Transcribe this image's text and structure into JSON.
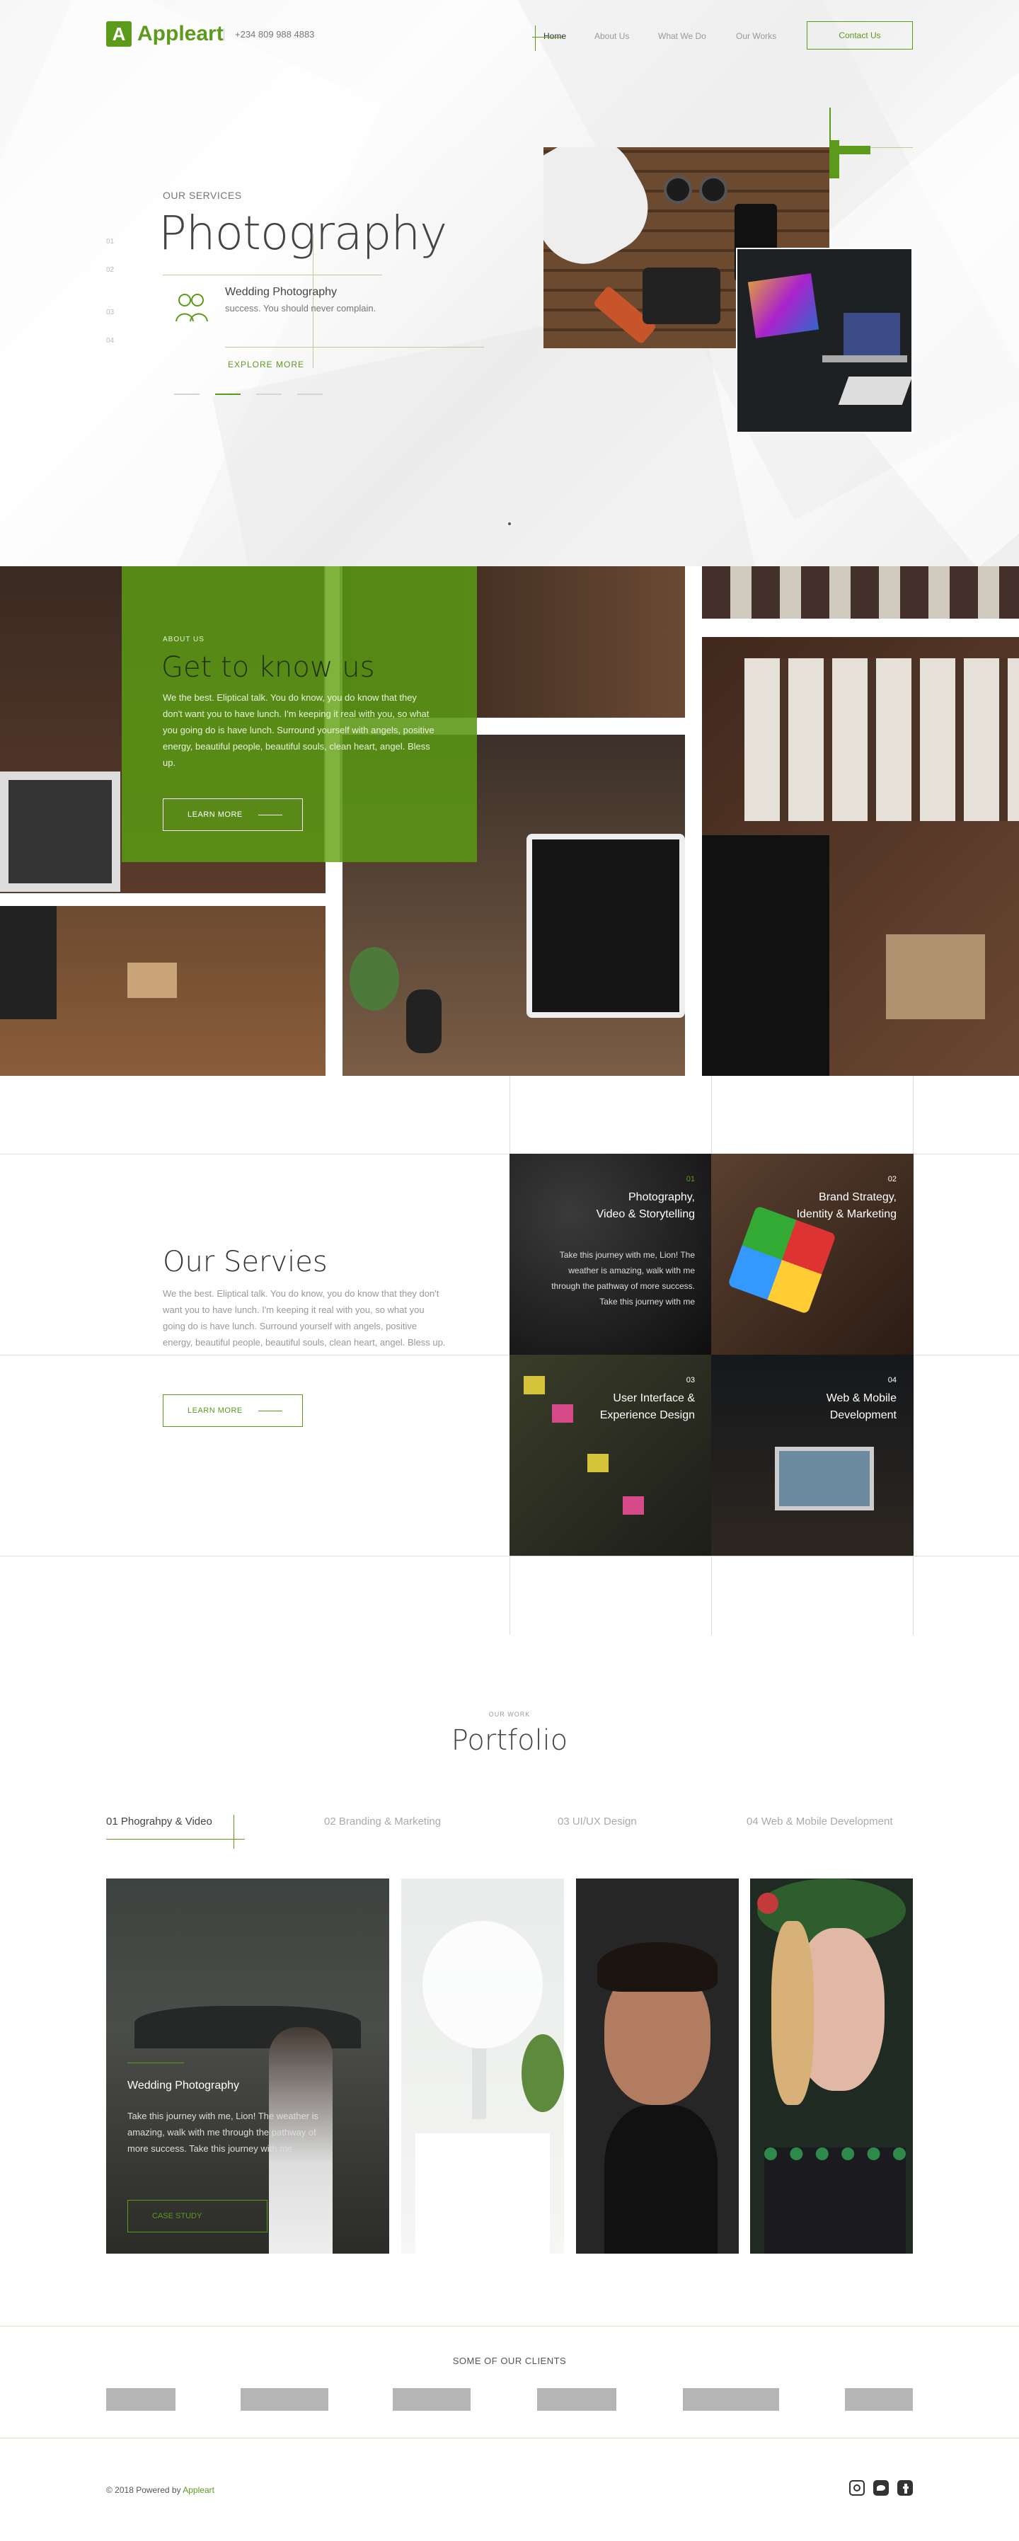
{
  "brand": {
    "logo_letter": "A",
    "name": "Appleart",
    "accent": "#5c9a1c"
  },
  "header": {
    "phone": "+234 809 988 4883",
    "nav": [
      "Home",
      "About Us",
      "What We Do",
      "Our Works"
    ],
    "contact": "Contact Us"
  },
  "hero": {
    "subtitle": "OUR SERVICES",
    "title": "Photography",
    "slides": [
      "01",
      "02",
      "03",
      "04"
    ],
    "item_title": "Wedding Photography",
    "item_text": "success. You should never complain.",
    "explore": "EXPLORE MORE"
  },
  "about": {
    "subtitle": "ABOUT US",
    "title": "Get to know us",
    "text": "We the best. Eliptical talk. You do know, you do know that they don't want you to have lunch. I'm keeping it real with you, so what you going do is have lunch. Surround yourself with angels, positive energy, beautiful people, beautiful souls, clean heart, angel. Bless up.",
    "button": "LEARN MORE"
  },
  "services": {
    "title": "Our Servies",
    "text": "We the best. Eliptical talk. You do know, you do know that they don't want you to have lunch. I'm keeping it real with you, so what you going do is have lunch. Surround yourself with angels, positive energy, beautiful people, beautiful souls, clean heart, angel. Bless up.",
    "button": "LEARN MORE",
    "tiles": [
      {
        "num": "01",
        "title1": "Photography,",
        "title2": "Video & Storytelling",
        "text": "Take this journey with me, Lion! The weather is amazing, walk with me through the pathway of more success. Take this journey with me"
      },
      {
        "num": "02",
        "title1": "Brand Strategy,",
        "title2": "Identity & Marketing",
        "text": ""
      },
      {
        "num": "03",
        "title1": "User Interface &",
        "title2": "Experience Design",
        "text": ""
      },
      {
        "num": "04",
        "title1": "Web & Mobile",
        "title2": "Development",
        "text": ""
      }
    ]
  },
  "portfolio": {
    "subtitle": "OUR WORK",
    "title": "Portfolio",
    "tabs": [
      "01 Phograhpy & Video",
      "02 Branding & Marketing",
      "03 UI/UX Design",
      "04 Web & Mobile Development"
    ],
    "case_title": "Wedding Photography",
    "case_text": "Take this journey with me, Lion! The weather is amazing, walk with me through the pathway of more success. Take this journey with me",
    "case_button": "CASE STUDY"
  },
  "clients": {
    "title": "SOME OF OUR CLIENTS"
  },
  "footer": {
    "text": "© 2018 Powered by",
    "brand": "Appleart"
  },
  "icons": [
    "instagram-icon",
    "twitter-icon",
    "facebook-icon"
  ]
}
